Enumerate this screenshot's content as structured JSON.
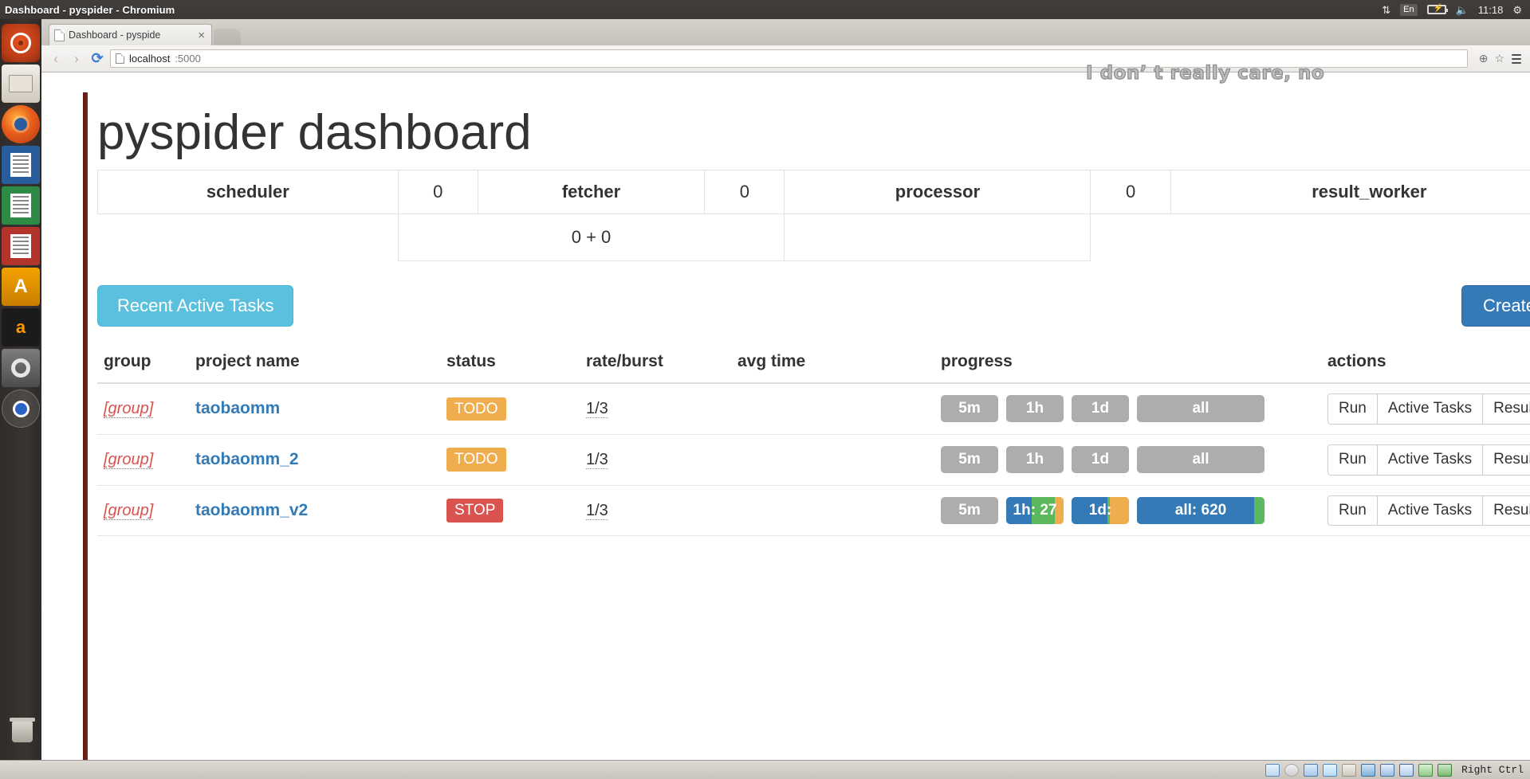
{
  "desktop": {
    "window_title": "Dashboard - pyspider - Chromium",
    "top_panel": {
      "network_icon": "network-updown-icon",
      "keyboard_layout": "En",
      "battery_icon": "battery-charging-icon",
      "volume_icon": "volume-icon",
      "clock": "11:18",
      "gear_icon": "gear-icon"
    },
    "launcher": [
      {
        "name": "ubuntu-dash",
        "label": "Dash home"
      },
      {
        "name": "files",
        "label": "Files"
      },
      {
        "name": "firefox",
        "label": "Firefox"
      },
      {
        "name": "libreoffice-writer",
        "label": "LibreOffice Writer"
      },
      {
        "name": "libreoffice-calc",
        "label": "LibreOffice Calc"
      },
      {
        "name": "libreoffice-impress",
        "label": "LibreOffice Impress"
      },
      {
        "name": "ubuntu-software",
        "label": "Ubuntu Software Center"
      },
      {
        "name": "amazon",
        "label": "Amazon"
      },
      {
        "name": "system-settings",
        "label": "System Settings"
      },
      {
        "name": "chromium",
        "label": "Chromium"
      },
      {
        "name": "trash",
        "label": "Trash"
      }
    ]
  },
  "browser": {
    "tab": {
      "title": "Dashboard - pyspide",
      "close_label": "×"
    },
    "back_label": "‹",
    "forward_label": "›",
    "reload_label": "⟳",
    "url_host": "localhost",
    "url_rest": ":5000",
    "zoom_icon": "zoom-icon",
    "star_icon": "star-icon",
    "menu_icon": "hamburger-menu-icon"
  },
  "overlay": {
    "text": "I don’  t really care, no"
  },
  "page": {
    "title": "pyspider dashboard",
    "counters": {
      "row1": [
        {
          "label": "scheduler",
          "value": "0"
        },
        {
          "label": "fetcher",
          "value": "0"
        },
        {
          "label": "processor",
          "value": "0"
        },
        {
          "label": "result_worker",
          "value": ""
        }
      ],
      "row2_value": "0 + 0"
    },
    "toolbar": {
      "recent_active_tasks": "Recent Active Tasks",
      "create": "Create"
    },
    "table": {
      "headers": [
        "group",
        "project name",
        "status",
        "rate/burst",
        "avg time",
        "progress",
        "actions"
      ],
      "rows": [
        {
          "group": "[group]",
          "project": "taobaomm",
          "status": "TODO",
          "status_style": "todo",
          "rate": "1/3",
          "avg_time": "",
          "progress": [
            {
              "label": "5m",
              "segments": []
            },
            {
              "label": "1h",
              "segments": []
            },
            {
              "label": "1d",
              "segments": []
            },
            {
              "label": "all",
              "segments": []
            }
          ],
          "actions": [
            "Run",
            "Active Tasks",
            "Results"
          ]
        },
        {
          "group": "[group]",
          "project": "taobaomm_2",
          "status": "TODO",
          "status_style": "todo",
          "rate": "1/3",
          "avg_time": "",
          "progress": [
            {
              "label": "5m",
              "segments": []
            },
            {
              "label": "1h",
              "segments": []
            },
            {
              "label": "1d",
              "segments": []
            },
            {
              "label": "all",
              "segments": []
            }
          ],
          "actions": [
            "Run",
            "Active Tasks",
            "Results"
          ]
        },
        {
          "group": "[group]",
          "project": "taobaomm_v2",
          "status": "STOP",
          "status_style": "stop",
          "rate": "1/3",
          "avg_time": "",
          "progress": [
            {
              "label": "5m",
              "segments": []
            },
            {
              "label": "1h: 27",
              "segments": [
                {
                  "color": "#337ab7",
                  "left": "0%",
                  "width": "45%"
                },
                {
                  "color": "#5cb85c",
                  "left": "45%",
                  "width": "40%"
                },
                {
                  "color": "#f0ad4e",
                  "left": "85%",
                  "width": "15%"
                }
              ]
            },
            {
              "label": "1d:",
              "segments": [
                {
                  "color": "#337ab7",
                  "left": "0%",
                  "width": "62%"
                },
                {
                  "color": "#5cb85c",
                  "left": "62%",
                  "width": "4%"
                },
                {
                  "color": "#f0ad4e",
                  "left": "66%",
                  "width": "34%"
                }
              ]
            },
            {
              "label": "all: 620",
              "segments": [
                {
                  "color": "#337ab7",
                  "left": "0%",
                  "width": "92%"
                },
                {
                  "color": "#5cb85c",
                  "left": "92%",
                  "width": "8%"
                }
              ]
            }
          ],
          "actions": [
            "Run",
            "Active Tasks",
            "Results"
          ]
        }
      ]
    }
  },
  "vbox_status": {
    "icons": [
      "hard-disk-icon",
      "optical-disk-icon",
      "network-adapter-icon",
      "usb-icon",
      "shared-folder-icon",
      "display-icon",
      "remote-desktop-icon",
      "cpu-icon",
      "mouse-integration-icon",
      "host-key-icon"
    ],
    "host_key": "Right Ctrl"
  },
  "colors": {
    "brand_primary": "#337ab7",
    "info": "#5bc0de",
    "warning": "#f0ad4e",
    "danger": "#d9534f",
    "success": "#5cb85c",
    "muted": "#adadad"
  }
}
